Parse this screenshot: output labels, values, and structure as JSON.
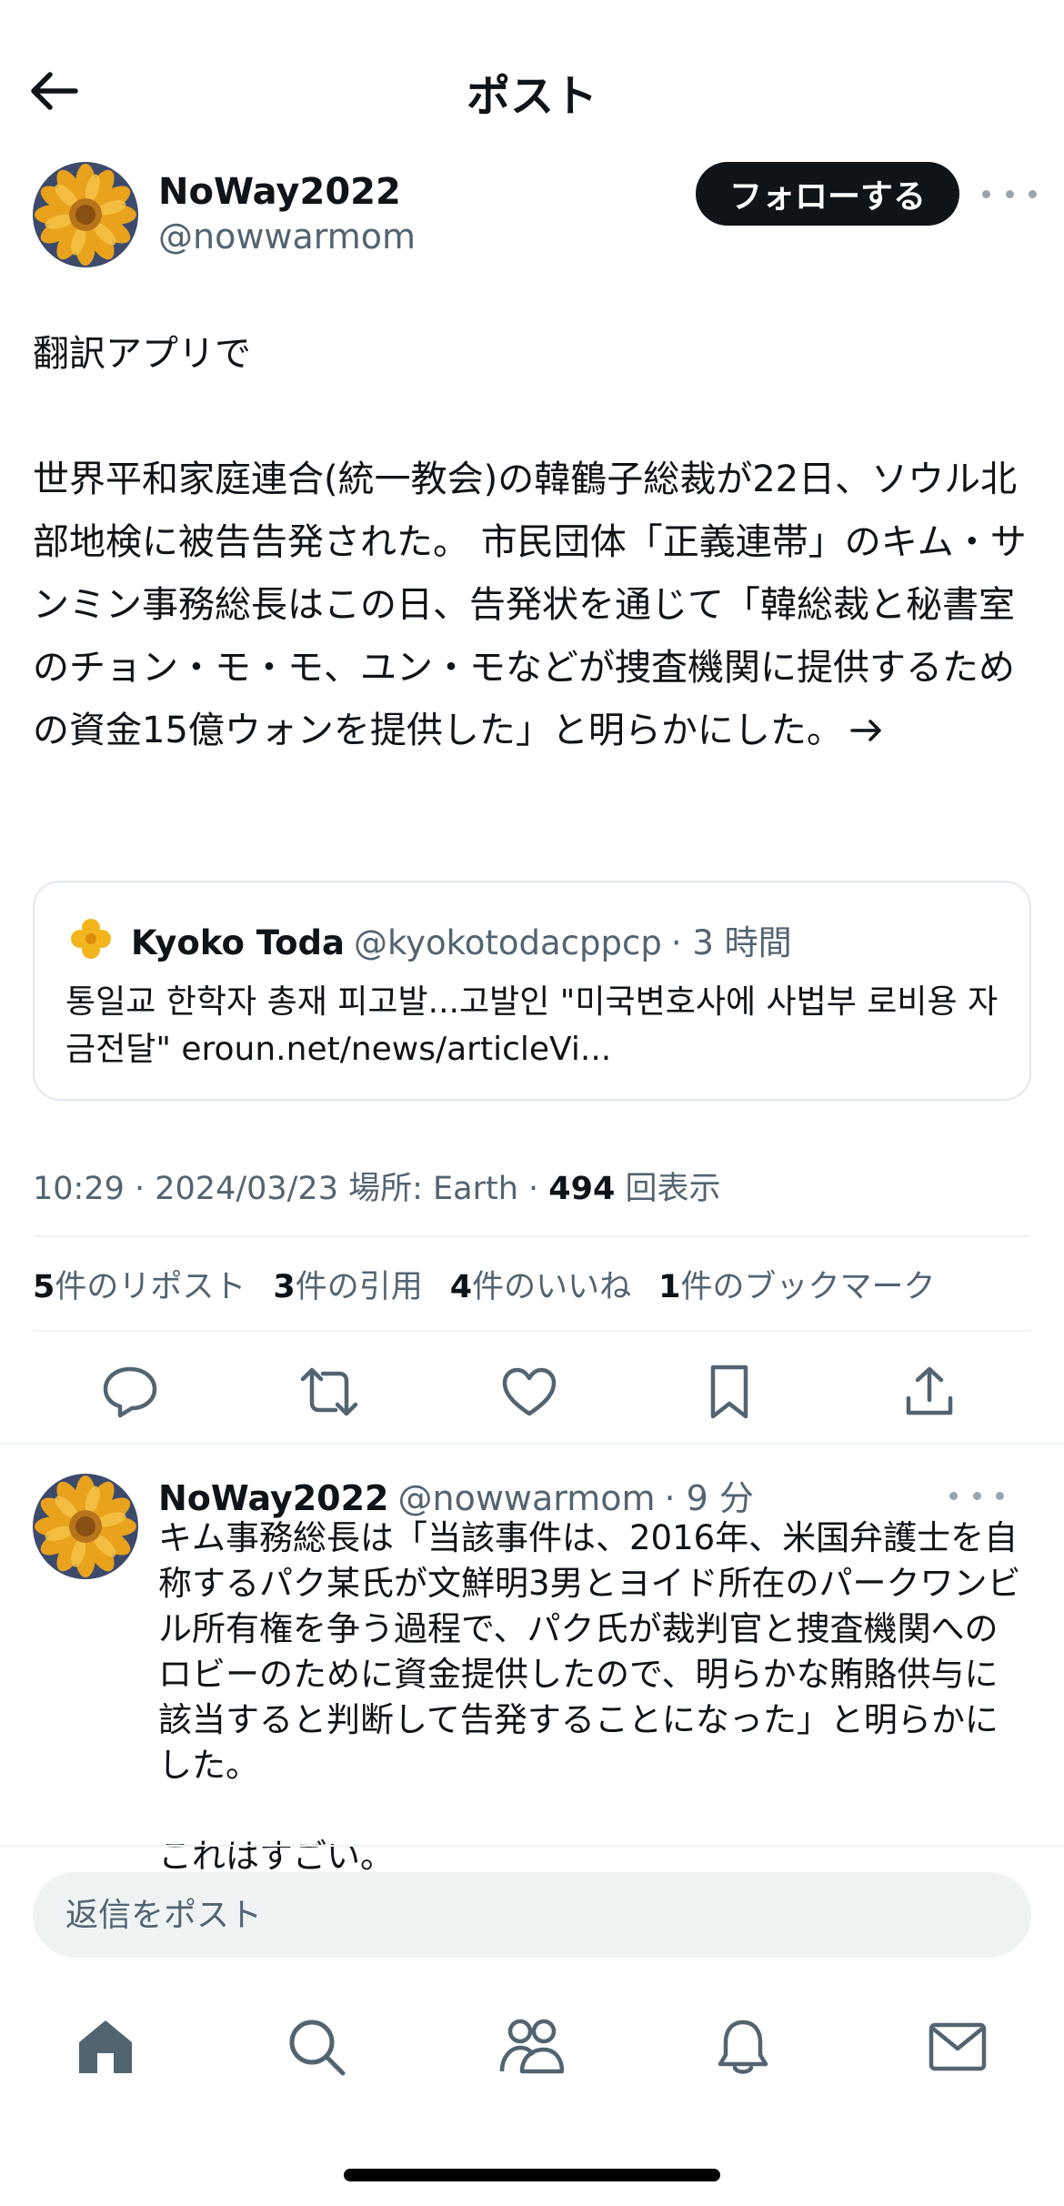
{
  "header": {
    "title": "ポスト"
  },
  "author": {
    "name": "NoWay2022",
    "handle": "@nowwarmom",
    "follow_label": "フォローする",
    "avatar": "sunflower-avatar"
  },
  "post": {
    "text": "翻訳アプリで\n\n世界平和家庭連合(統一教会)の韓鶴子総裁が22日、ソウル北部地検に被告告発された。 市民団体「正義連帯」のキム・サンミン事務総長はこの日、告発状を通じて「韓総裁と秘書室のチョン・モ・モ、ユン・モなどが捜査機関に提供するための資金15億ウォンを提供した」と明らかにした。",
    "trailing_icon": "right-arrow-icon"
  },
  "quote": {
    "name": "Kyoko Toda",
    "handle": "@kyokotodacppcp",
    "time": "· 3 時間",
    "text": "통일교 한학자 총재 피고발...고발인 \"미국변호사에 사법부 로비용 자금전달\" eroun.net/news/articleVi..."
  },
  "meta": {
    "time": "10:29 · 2024/03/23",
    "location": "場所: Earth ·",
    "views_count": "494",
    "views_label": "回表示"
  },
  "stats": [
    {
      "count": "5",
      "label": "件のリポスト"
    },
    {
      "count": "3",
      "label": "件の引用"
    },
    {
      "count": "4",
      "label": "件のいいね"
    },
    {
      "count": "1",
      "label": "件のブックマーク"
    }
  ],
  "actions": [
    "reply-icon",
    "repost-icon",
    "like-icon",
    "bookmark-icon",
    "share-icon"
  ],
  "reply": {
    "name": "NoWay2022",
    "handle": "@nowwarmom",
    "time": "· 9 分",
    "text": "キム事務総長は「当該事件は、2016年、米国弁護士を自称するパク某氏が文鮮明3男とヨイド所在のパークワンビル所有権を争う過程で、パク氏が裁判官と捜査機関へのロビーのために資金提供したので、明らかな賄賂供与に該当すると判断して告発することになった」と明らかにした。\n\nこれはすごい。"
  },
  "composer": {
    "placeholder": "返信をポスト"
  },
  "tabbar": [
    "home-icon",
    "search-icon",
    "communities-icon",
    "notifications-icon",
    "messages-icon"
  ]
}
